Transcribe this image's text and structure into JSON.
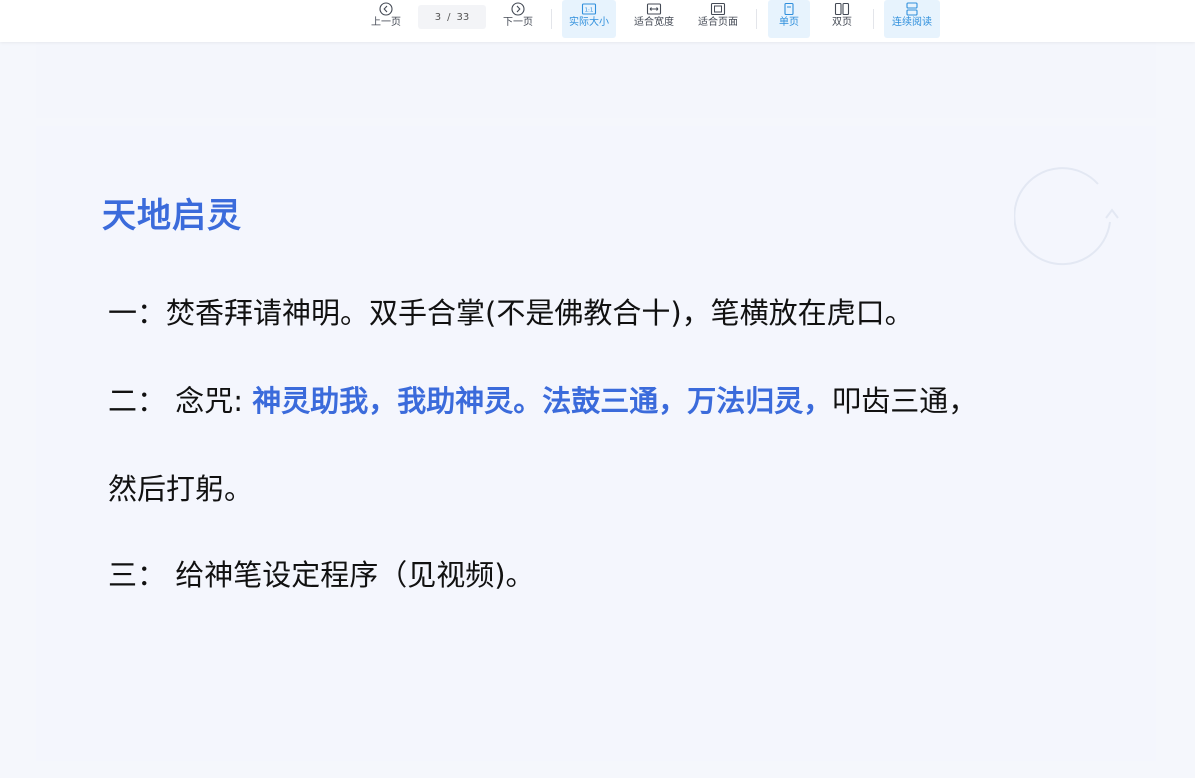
{
  "toolbar": {
    "prev_label": "上一页",
    "current_page": "3",
    "separator": "/",
    "total_pages": "33",
    "next_label": "下一页",
    "actual_size_label": "实际大小",
    "fit_width_label": "适合宽度",
    "fit_page_label": "适合页面",
    "single_page_label": "单页",
    "double_page_label": "双页",
    "continuous_label": "连续阅读",
    "accent_color": "#2f8fdc",
    "active_buttons": [
      "actual_size",
      "single_page",
      "continuous"
    ]
  },
  "document": {
    "heading": "天地启灵",
    "heading_color": "#3b6bdb",
    "line1": "一：焚香拜请神明。双手合掌(不是佛教合十)，笔横放在虎口。",
    "line2_prefix": "二：  念咒: ",
    "line2_highlight": "神灵助我，我助神灵。法鼓三通，万法归灵，",
    "line2_suffix": "叩齿三通，",
    "line3": "然后打躬。",
    "line4": "三：  给神笔设定程序（见视频)。",
    "highlight_color": "#3b6bdb"
  }
}
